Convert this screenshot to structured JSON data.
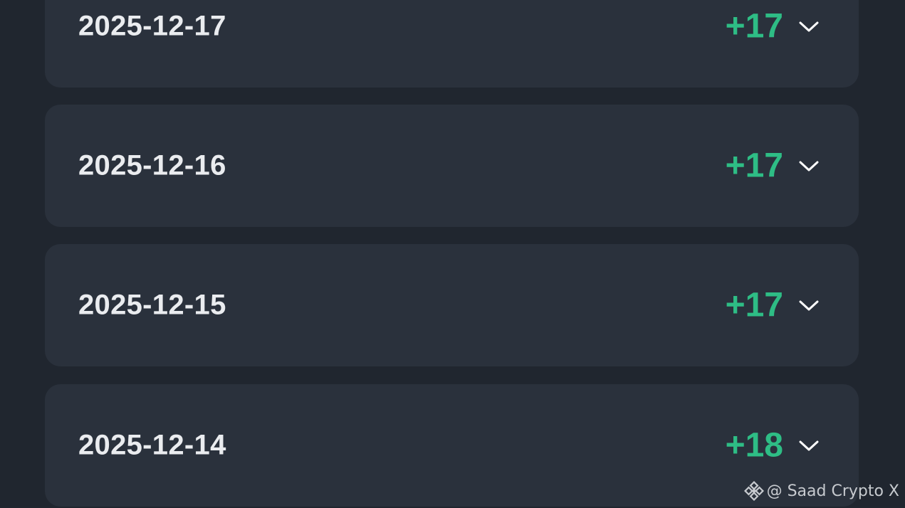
{
  "colors": {
    "background": "#20262f",
    "card": "#2a313c",
    "date_text": "#eaecef",
    "positive": "#2ebd85"
  },
  "rows": [
    {
      "date": "2025-12-17",
      "points": "+17",
      "icon": "chevron-down-icon"
    },
    {
      "date": "2025-12-16",
      "points": "+17",
      "icon": "chevron-down-icon"
    },
    {
      "date": "2025-12-15",
      "points": "+17",
      "icon": "chevron-down-icon"
    },
    {
      "date": "2025-12-14",
      "points": "+18",
      "icon": "chevron-down-icon"
    }
  ],
  "watermark": {
    "icon": "binance-logo-icon",
    "text": "@ Saad Crypto X"
  }
}
